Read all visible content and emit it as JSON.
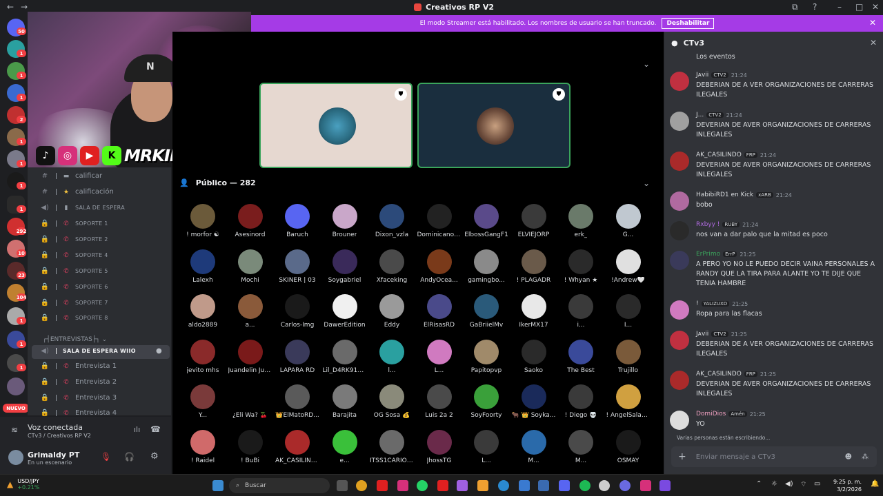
{
  "window": {
    "title": "Creativos RP V2"
  },
  "banner": {
    "text": "El modo Streamer está habilitado. Los nombres de usuario se han truncado.",
    "button": "Deshabilitar"
  },
  "rail": {
    "badges": [
      "50",
      "1",
      "1",
      "1",
      "2",
      "1",
      "1",
      "1",
      "1",
      "292",
      "10",
      "23",
      "104",
      "1",
      "1",
      "1"
    ],
    "new_label": "NUEVO"
  },
  "overlay": {
    "handle": "MRKINGMUSIC"
  },
  "channels": {
    "items": [
      {
        "label": "calificar",
        "emoji": "▬",
        "small": false,
        "icon": "#"
      },
      {
        "label": "calificación",
        "emoji": "★",
        "small": false,
        "icon": "#"
      },
      {
        "label": "SALA DE ESPERA",
        "emoji": "▮",
        "small": true,
        "icon": "🔊"
      },
      {
        "label": "SOPORTE 1",
        "emoji": "📞",
        "small": true,
        "icon": "🔒"
      },
      {
        "label": "SOPORTE 2",
        "emoji": "📞",
        "small": true,
        "icon": "🔒"
      },
      {
        "label": "SOPORTE 4",
        "emoji": "📞",
        "small": true,
        "icon": "🔒"
      },
      {
        "label": "SOPORTE 5",
        "emoji": "📞",
        "small": true,
        "icon": "🔒"
      },
      {
        "label": "SOPORTE 6",
        "emoji": "📞",
        "small": true,
        "icon": "🔒"
      },
      {
        "label": "SOPORTE 7",
        "emoji": "📞",
        "small": true,
        "icon": "🔒"
      },
      {
        "label": "SOPORTE 8",
        "emoji": "📞",
        "small": true,
        "icon": "🔒"
      }
    ],
    "category": "┌┤ENTREVISTAS├┐",
    "active": "SALA DE ESPERA WIIO",
    "interviews": [
      "Entrevista 1",
      "Entrevista 2",
      "Entrevista 3",
      "Entrevista 4"
    ]
  },
  "voice": {
    "status": "Voz conectada",
    "sub": "CTv3 / Creativos RP V2",
    "user": "Grimaldy PT",
    "user_status": "En un escenario"
  },
  "stage": {
    "audience_label": "Público — 282"
  },
  "members": [
    "! morfor ☯",
    "Asesinord",
    "Baruch",
    "Brouner",
    "Dixon_vzla",
    "DominicanoG...",
    "ElbossGangF1",
    "ELVIEJORP",
    "erk_",
    "G...",
    "Lalexh",
    "Mochi",
    "SKINER | 03",
    "Soygabriel",
    "Xfaceking",
    "AndyOcea...",
    "gamingbo...",
    "! PLAGADR",
    "! Whyan ★",
    "!Andrew🤍",
    "aldo2889",
    "a...",
    "Carlos-Img",
    "DawerEdition",
    "Eddy",
    "ElRisasRD",
    "GaBriielMv",
    "IkerMX17",
    "i...",
    "I...",
    "jevito mhs",
    "Juandelin Jue...",
    "LAPARA RD",
    "Lil_D4RK914 ...",
    "l...",
    "L...",
    "Papitopvp",
    "Saoko",
    "The Best",
    "Trujillo",
    "Y...",
    "¿Eli Wa? 🍒",
    "👑ElMatoRD...",
    "Barajita",
    "OG Sosa 💰",
    "Luis 2a 2",
    "SoyFoorty",
    "🐂 👑 Soyka...",
    "! Diego 💀",
    "! AngelSalasRD",
    "! Raidel",
    "! BuBi",
    "AK_CASILINDO",
    "e...",
    "ITSS1CARIO O...",
    "JhossTG",
    "L...",
    "M...",
    "M...",
    "OSMAY"
  ],
  "member_colors": [
    "#6b5a3a",
    "#7a1d1d",
    "#5865f2",
    "#c9a7c9",
    "#2c4a7a",
    "#222",
    "#5a4a8a",
    "#3a3a3a",
    "#6a7a6a",
    "#c0c8d0",
    "#1e3a7a",
    "#7a8a7a",
    "#5a6a8a",
    "#3a2a5a",
    "#4a4a4a",
    "#7a3a1a",
    "#8a8a8a",
    "#6a5a4a",
    "#2a2a2a",
    "#e0e0e0",
    "#c09a8a",
    "#8a5a3a",
    "#1a1a1a",
    "#f0f0f0",
    "#9a9a9a",
    "#4a4a8a",
    "#2a5a7a",
    "#e8e8e8",
    "#3a3a3a",
    "#2a2a2a",
    "#8a2a2a",
    "#7a1a1a",
    "#3a3a5a",
    "#6a6a6a",
    "#2aa0a0",
    "#d07ac0",
    "#a08a6a",
    "#2a2a2a",
    "#3a4a9a",
    "#7a5a3a",
    "#7a3a3a",
    "#000",
    "#5a5a5a",
    "#7a7a7a",
    "#8a8a7a",
    "#4a4a4a",
    "#3aa03a",
    "#1a2a5a",
    "#3a3a3a",
    "#d0a040",
    "#d06a6a",
    "#1a1a1a",
    "#aa2a2a",
    "#3ac03a",
    "#6a6a6a",
    "#6a2a4a",
    "#3a3a3a",
    "#2a6aaa",
    "#4a4a4a",
    "#1a1a1a"
  ],
  "chat": {
    "title": "CTv3",
    "messages": [
      {
        "author": "",
        "tags": [],
        "time": "",
        "text": "Los eventos",
        "color": "#dbdee1",
        "av": ""
      },
      {
        "author": "Jᴀvii",
        "tags": [
          "CTV2"
        ],
        "time": "21:24",
        "text": "DEBERIAN DE A VER ORGANIZACIONES DE CARRERAS ILEGALES",
        "color": "#dbdee1",
        "av": "#c03040"
      },
      {
        "author": "J...",
        "tags": [
          "CTV2"
        ],
        "time": "21:24",
        "text": "DEVERIAN DE AVER  ORGANIZACIONES DE CARRERAS INLEGALES",
        "color": "#dbdee1",
        "av": "#a0a0a0"
      },
      {
        "author": "AK_CASILINDO",
        "tags": [
          "FRP"
        ],
        "time": "21:24",
        "text": "DEVERIAN DE AVER  ORGANIZACIONES DE CARRERAS INLEGALES",
        "color": "#dbdee1",
        "av": "#aa2a2a"
      },
      {
        "author": "HabibiRD1 en Kick",
        "tags": [
          "xARB"
        ],
        "time": "21:24",
        "text": "bobo",
        "color": "#dbdee1",
        "av": "#b06aa0"
      },
      {
        "author": "Rxbyy !",
        "tags": [
          "RUBY"
        ],
        "time": "21:24",
        "text": "nos van a dar palo que la mitad es poco",
        "color": "#b06ae0",
        "av": "#2a2a2a"
      },
      {
        "author": "ErPrimo",
        "tags": [
          "ErrP"
        ],
        "time": "21:25",
        "text": "A PERO YO NO LE PUEDO DECIR VAINA PERSONALES A RANDY QUE LA TIRA PARA ALANTE YO TE DIJE QUE TENIA HAMBRE",
        "color": "#3ba55c",
        "av": "#3a3a5a"
      },
      {
        "author": "!",
        "tags": [
          "YALIZUXD"
        ],
        "time": "21:25",
        "text": "Ropa para las flacas",
        "color": "#dbdee1",
        "av": "#d07ac0"
      },
      {
        "author": "Jᴀvii",
        "tags": [
          "CTV2"
        ],
        "time": "21:25",
        "text": "DEBERIAN DE A VER ORGANIZACIONES DE CARRERAS ILEGALES",
        "color": "#dbdee1",
        "av": "#c03040"
      },
      {
        "author": "AK_CASILINDO",
        "tags": [
          "FRP"
        ],
        "time": "21:25",
        "text": "DEVERIAN DE AVER  ORGANIZACIONES DE CARRERAS INLEGALES",
        "color": "#dbdee1",
        "av": "#aa2a2a"
      },
      {
        "author": "DomiDios",
        "tags": [
          "Amén"
        ],
        "time": "21:25",
        "text": "YO",
        "color": "#f0a0c0",
        "av": "#ddd"
      }
    ],
    "typing": "Varias personas están escribiendo...",
    "input_placeholder": "Enviar mensaje a CTv3"
  },
  "taskbar": {
    "stock_name": "USD/JPY",
    "stock_change": "+0.21%",
    "search": "Buscar",
    "time": "9:25 p. m.",
    "date": "3/2/2026"
  }
}
